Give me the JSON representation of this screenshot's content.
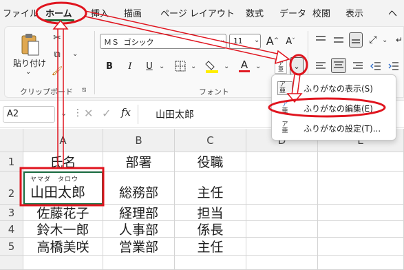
{
  "menu": {
    "items": [
      "ファイル",
      "ホーム",
      "挿入",
      "描画",
      "ページ レイアウト",
      "数式",
      "データ",
      "校閲",
      "表示",
      "ヘ"
    ],
    "active": "ホーム"
  },
  "ribbon": {
    "clipboard": {
      "paste_label": "貼り付け",
      "group_label": "クリップボード"
    },
    "font": {
      "font_name": "ＭＳ ゴシック",
      "font_size": "11",
      "group_label": "フォント",
      "grow_label": "A",
      "shrink_label": "A",
      "bold": "B",
      "italic": "I",
      "underline": "U",
      "font_color_letter": "A",
      "font_color": "#e01b24",
      "fill_color": "#ffee00"
    }
  },
  "formula_bar": {
    "name_box": "A2",
    "fx": "fx",
    "value": "山田太郎"
  },
  "grid": {
    "columns": [
      "A",
      "B",
      "C",
      "D",
      "E"
    ],
    "rows": [
      "1",
      "2",
      "3",
      "4",
      "5"
    ],
    "headers": [
      "氏名",
      "部署",
      "役職"
    ],
    "data": [
      [
        "山田太郎",
        "総務部",
        "主任"
      ],
      [
        "佐藤花子",
        "経理部",
        "担当"
      ],
      [
        "鈴木一郎",
        "人事部",
        "係長"
      ],
      [
        "高橋美咲",
        "営業部",
        "主任"
      ]
    ],
    "furigana": "ヤマダ　タロウ"
  },
  "dropdown": {
    "items": [
      {
        "label": "ふりがなの表示(S)",
        "icon": "furigana-show-icon"
      },
      {
        "label": "ふりがなの編集(E)",
        "icon": "furigana-edit-icon"
      },
      {
        "label": "ふりがなの設定(T)...",
        "icon": "furigana-settings-icon"
      }
    ]
  },
  "colors": {
    "accent_green": "#1f6b3a",
    "annotation_red": "#e0141e",
    "selection_green": "#1e7145"
  }
}
